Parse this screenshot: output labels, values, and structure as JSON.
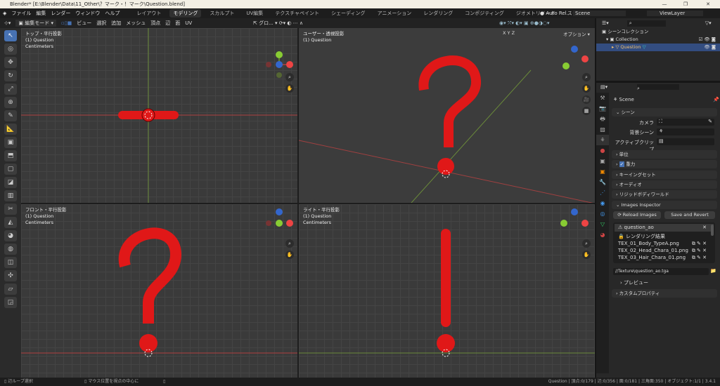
{
  "title": "Blender* [E:\\Blender\\Data\\11_Other\\？マーク・！マーク\\Question.blend]",
  "menu": [
    "ファイル",
    "編集",
    "レンダー",
    "ウィンドウ",
    "ヘルプ"
  ],
  "workspaces": [
    "レイアウト",
    "モデリング",
    "スカルプト",
    "UV編集",
    "テクスチャペイント",
    "シェーディング",
    "アニメーション",
    "レンダリング",
    "コンポジティング",
    "ジオメトリノード",
    "スクリプト作成",
    "+"
  ],
  "active_workspace": "モデリング",
  "topright": {
    "autorel": "Auto Rel...",
    "scene": "Scene",
    "viewlayer": "ViewLayer"
  },
  "header": {
    "mode": "編集モード",
    "menus": [
      "ビュー",
      "選択",
      "追加",
      "メッシュ",
      "頂点",
      "辺",
      "面",
      "UV"
    ],
    "transform": "グロ...",
    "options": "オプション",
    "xyz": [
      "X",
      "Y",
      "Z"
    ]
  },
  "viewports": [
    {
      "title": "トップ・平行投影",
      "object": "(1) Question",
      "units": "Centimeters"
    },
    {
      "title": "ユーザー・透視投影",
      "object": "(1) Question"
    },
    {
      "title": "フロント・平行投影",
      "object": "(1) Question",
      "units": "Centimeters"
    },
    {
      "title": "ライト・平行投影",
      "object": "(1) Question",
      "units": "Centimeters"
    }
  ],
  "outliner": {
    "root": "シーンコレクション",
    "collection": "Collection",
    "object": "Question"
  },
  "props": {
    "scene_name": "Scene",
    "scene_panel": "シーン",
    "camera_label": "カメラ",
    "bg_scene_label": "背景シーン",
    "clip_label": "アクティブクリップ",
    "panels": [
      "単位",
      "重力",
      "キーイングセット",
      "オーディオ",
      "リジッドボディワールド"
    ],
    "images_inspector": "Images Inspector",
    "reload": "Reload Images",
    "save_revert": "Save and Revert",
    "images": [
      "question_ao",
      "レンダリング結果",
      "TEX_01_Body_TypeA.png",
      "TEX_02_Head_Chara_01.png",
      "TEX_03_Hair_Chara_01.png"
    ],
    "path": "//Texture\\question_ao.tga",
    "preview": "プレビュー",
    "custom": "カスタムプロパティ"
  },
  "status": {
    "left": "辺ループ選択",
    "mid": "マウス位置を視点の中心に",
    "right": "Question | 頂点:0/179 | 辺:0/356 | 面:0/181 | 三角面:350 | オブジェクト:1/1 | 3.4.1"
  }
}
